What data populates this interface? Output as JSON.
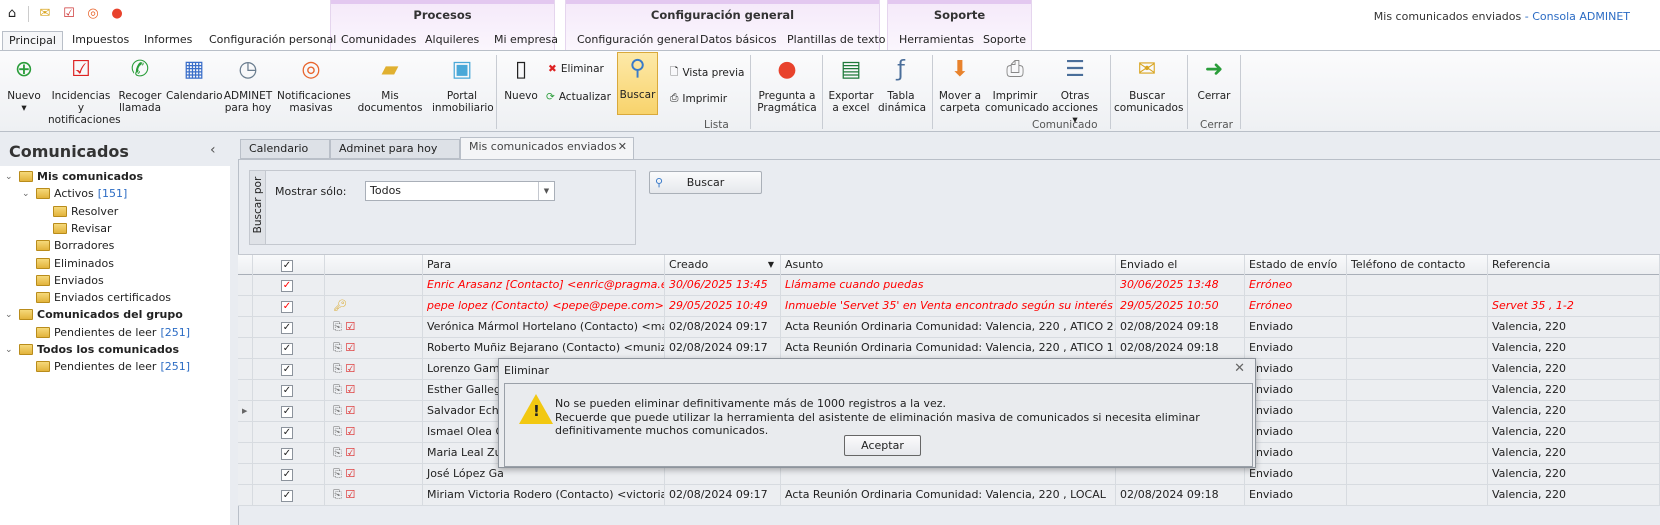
{
  "quick_access": [
    "home-icon",
    "mail-icon",
    "tasks-icon",
    "broadcast-icon",
    "pragmatica-icon"
  ],
  "window_title": {
    "main": "Mis comunicados enviados",
    "separator": " - ",
    "app": "Consola ADMINET"
  },
  "context_groups": [
    "Procesos",
    "Configuración general",
    "Soporte"
  ],
  "tabs": [
    "Principal",
    "Impuestos",
    "Informes",
    "Configuración personal",
    "Comunidades",
    "Alquileres",
    "Mi empresa",
    "Configuración general",
    "Datos básicos",
    "Plantillas de texto",
    "Herramientas",
    "Soporte"
  ],
  "ribbon": {
    "nuevo": "Nuevo",
    "incidencias": "Incidencias y notificaciones",
    "recoger": "Recoger llamada",
    "calendario": "Calendario",
    "adminet": "ADMINET para hoy",
    "notificaciones": "Notificaciones masivas",
    "documentos": "Mis documentos",
    "portal": "Portal inmobiliario",
    "nuevo2": "Nuevo",
    "eliminar": "Eliminar",
    "actualizar": "Actualizar",
    "buscar": "Buscar",
    "vista_previa": "Vista previa",
    "imprimir": "Imprimir",
    "pregunta": "Pregunta a Pragmática",
    "exportar": "Exportar a excel",
    "tabla": "Tabla dinámica",
    "lista_group": "Lista",
    "mover": "Mover a carpeta",
    "imprimir_com": "Imprimir comunicado",
    "otras": "Otras acciones",
    "buscar_com": "Buscar comunicados",
    "comunicado_group": "Comunicado",
    "cerrar": "Cerrar",
    "cerrar_group": "Cerrar"
  },
  "sidebar": {
    "title": "Comunicados",
    "collapse": "‹",
    "items": [
      {
        "label": "Mis comunicados",
        "count": ""
      },
      {
        "label": "Activos",
        "count": "[151]"
      },
      {
        "label": "Resolver",
        "count": ""
      },
      {
        "label": "Revisar",
        "count": ""
      },
      {
        "label": "Borradores",
        "count": ""
      },
      {
        "label": "Eliminados",
        "count": ""
      },
      {
        "label": "Enviados",
        "count": ""
      },
      {
        "label": "Enviados certificados",
        "count": ""
      },
      {
        "label": "Comunicados del grupo",
        "count": ""
      },
      {
        "label": "Pendientes de leer",
        "count": "[251]"
      },
      {
        "label": "Todos los comunicados",
        "count": ""
      },
      {
        "label": "Pendientes de leer",
        "count": "[251]"
      }
    ]
  },
  "doc_tabs": [
    "Calendario",
    "Adminet para hoy",
    "Mis comunicados enviados"
  ],
  "filter": {
    "group_label": "Buscar por",
    "mostrar_label": "Mostrar sólo:",
    "mostrar_value": "Todos",
    "buscar": "Buscar"
  },
  "grid": {
    "columns": [
      "",
      "Para",
      "Creado",
      "Asunto",
      "Enviado el",
      "Estado de envío",
      "Teléfono de contacto",
      "Referencia"
    ],
    "rows": [
      {
        "para": "Enric Arasanz [Contacto] <enric@pragma.es>;",
        "creado": "30/06/2025 13:45",
        "asunto": "Llámame cuando puedas",
        "enviado": "30/06/2025 13:48",
        "estado": "Erróneo",
        "ref": ""
      },
      {
        "para": "pepe lopez (Contacto) <pepe@pepe.com>",
        "creado": "29/05/2025 10:49",
        "asunto": "Inmueble 'Servet 35' en Venta encontrado según su interés",
        "enviado": "29/05/2025 10:50",
        "estado": "Erróneo",
        "ref": "Servet 35 , 1-2"
      },
      {
        "para": "Verónica Mármol Hortelano (Contacto) <marmol@...",
        "creado": "02/08/2024 09:17",
        "asunto": "Acta Reunión  Ordinaria Comunidad: Valencia, 220  , ATICO 2",
        "enviado": "02/08/2024 09:18",
        "estado": "Enviado",
        "ref": "Valencia, 220"
      },
      {
        "para": "Roberto Muñiz Bejarano (Contacto) <muniz@pra...",
        "creado": "02/08/2024 09:17",
        "asunto": "Acta Reunión  Ordinaria Comunidad: Valencia, 220  , ATICO 1",
        "enviado": "02/08/2024 09:18",
        "estado": "Enviado",
        "ref": "Valencia, 220"
      },
      {
        "para": "Lorenzo Gambo",
        "creado": "",
        "asunto": "",
        "enviado": "",
        "estado": "Enviado",
        "ref": "Valencia, 220"
      },
      {
        "para": "Esther Gallegos",
        "creado": "",
        "asunto": "",
        "enviado": "",
        "estado": "Enviado",
        "ref": "Valencia, 220"
      },
      {
        "para": "Salvador Echev",
        "creado": "",
        "asunto": "",
        "enviado": "",
        "estado": "Enviado",
        "ref": "Valencia, 220"
      },
      {
        "para": "Ismael Olea Gu",
        "creado": "",
        "asunto": "",
        "enviado": "",
        "estado": "Enviado",
        "ref": "Valencia, 220"
      },
      {
        "para": "Maria Leal Zurit",
        "creado": "",
        "asunto": "",
        "enviado": "",
        "estado": "Enviado",
        "ref": "Valencia, 220"
      },
      {
        "para": "José López Ga",
        "creado": "",
        "asunto": "",
        "enviado": "",
        "estado": "Enviado",
        "ref": "Valencia, 220"
      },
      {
        "para": "Miriam Victoria Rodero (Contacto) <victoria@prag...",
        "creado": "02/08/2024 09:17",
        "asunto": "Acta Reunión  Ordinaria Comunidad: Valencia, 220  , LOCAL",
        "enviado": "02/08/2024 09:18",
        "estado": "Enviado",
        "ref": "Valencia, 220"
      }
    ]
  },
  "dialog": {
    "title": "Eliminar",
    "line1": "No se pueden eliminar definitivamente más de 1000 registros a la vez.",
    "line2": "Recuerde que puede utilizar la herramienta del asistente de eliminación masiva de comunicados si necesita eliminar definitivamente muchos comunicados.",
    "ok": "Aceptar"
  },
  "colors": {
    "error": "#ff0000",
    "link": "#2c6cc4",
    "context": "#e3c8f0"
  }
}
